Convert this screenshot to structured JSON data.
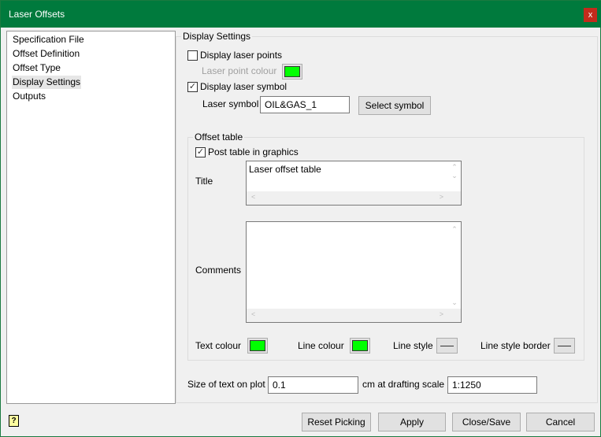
{
  "window": {
    "title": "Laser Offsets",
    "close": "x"
  },
  "nav": {
    "items": [
      "Specification File",
      "Offset Definition",
      "Offset Type",
      "Display Settings",
      "Outputs"
    ],
    "selected": "Display Settings"
  },
  "display": {
    "group_label": "Display Settings",
    "display_laser_points": {
      "label": "Display laser points",
      "checked": false
    },
    "laser_point_colour": {
      "label": "Laser point colour",
      "color": "#00ff00"
    },
    "display_laser_symbol": {
      "label": "Display laser symbol",
      "checked": true
    },
    "laser_symbol": {
      "label": "Laser symbol",
      "value": "OIL&GAS_1",
      "button": "Select symbol"
    }
  },
  "offset_table": {
    "group_label": "Offset table",
    "post_table": {
      "label": "Post table in graphics",
      "checked": true
    },
    "title": {
      "label": "Title",
      "value": "Laser offset table"
    },
    "comments": {
      "label": "Comments",
      "value": ""
    },
    "text_colour": {
      "label": "Text colour",
      "color": "#00ff00"
    },
    "line_colour": {
      "label": "Line colour",
      "color": "#00ff00"
    },
    "line_style": {
      "label": "Line style"
    },
    "line_style_border": {
      "label": "Line style border"
    }
  },
  "size": {
    "label": "Size of text on plot",
    "value": "0.1",
    "scale_label": "cm at drafting scale",
    "scale_value": "1:1250"
  },
  "buttons": {
    "reset": "Reset Picking",
    "apply": "Apply",
    "close_save": "Close/Save",
    "cancel": "Cancel"
  },
  "help": "?"
}
